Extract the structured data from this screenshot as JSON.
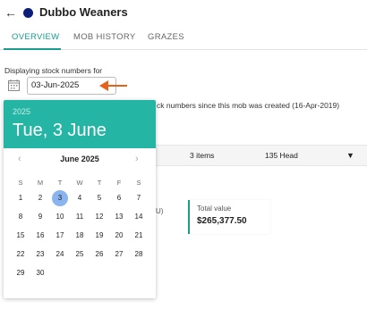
{
  "header": {
    "back_icon": "arrow-left-icon",
    "mob_color": "#0b1f7a",
    "title": "Dubbo Weaners"
  },
  "tabs": [
    {
      "label": "OVERVIEW",
      "active": true
    },
    {
      "label": "MOB HISTORY",
      "active": false
    },
    {
      "label": "GRAZES",
      "active": false
    }
  ],
  "stock": {
    "displaying_label": "Displaying stock numbers for",
    "date_value": "03-Jun-2025",
    "note": "ck numbers since this mob was created (16-Apr-2019)"
  },
  "summary": {
    "items": "3 items",
    "head": "135 Head",
    "dropdown_icon": "triangle-down-icon"
  },
  "cards": {
    "prev_fragment": "U)",
    "total_value_label": "Total value",
    "total_value": "$265,377.50"
  },
  "picker": {
    "year": "2025",
    "selected_long": "Tue, 3 June",
    "month_label": "June 2025",
    "weekdays": [
      "S",
      "M",
      "T",
      "W",
      "T",
      "F",
      "S"
    ],
    "weeks": [
      [
        "1",
        "2",
        "3",
        "4",
        "5",
        "6",
        "7"
      ],
      [
        "8",
        "9",
        "10",
        "11",
        "12",
        "13",
        "14"
      ],
      [
        "15",
        "16",
        "17",
        "18",
        "19",
        "20",
        "21"
      ],
      [
        "22",
        "23",
        "24",
        "25",
        "26",
        "27",
        "28"
      ],
      [
        "29",
        "30",
        "",
        "",
        "",
        "",
        ""
      ]
    ],
    "selected_day": "3",
    "accent_color": "#24b5a4",
    "selected_color": "#8ab4ee"
  },
  "colors": {
    "teal": "#1a9c8e",
    "arrow": "#e8601c"
  }
}
